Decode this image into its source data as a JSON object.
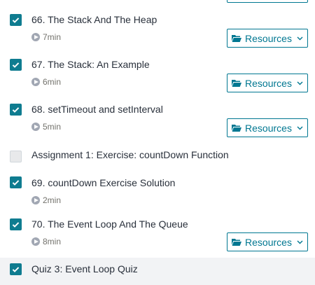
{
  "colors": {
    "accent": "#007791",
    "checkbox": "#0f7c90",
    "active_row": "#f2f3f5"
  },
  "items": [
    {
      "title": "66. The Stack And The Heap",
      "duration": "7min",
      "checked": true,
      "resources": "Resources"
    },
    {
      "title": "67. The Stack: An Example",
      "duration": "6min",
      "checked": true,
      "resources": "Resources"
    },
    {
      "title": "68. setTimeout and setInterval",
      "duration": "5min",
      "checked": true,
      "resources": "Resources"
    },
    {
      "title": "Assignment 1: Exercise: countDown Function",
      "checked": false
    },
    {
      "title": "69. countDown Exercise Solution",
      "duration": "2min",
      "checked": true
    },
    {
      "title": "70. The Event Loop And The Queue",
      "duration": "8min",
      "checked": true,
      "resources": "Resources"
    },
    {
      "title": "Quiz 3: Event Loop Quiz",
      "checked": true,
      "active": true
    }
  ],
  "icons": {
    "checkbox": "check-icon",
    "play": "play-circle-icon",
    "folder": "folder-open-icon",
    "dropdown": "chevron-down-icon"
  }
}
